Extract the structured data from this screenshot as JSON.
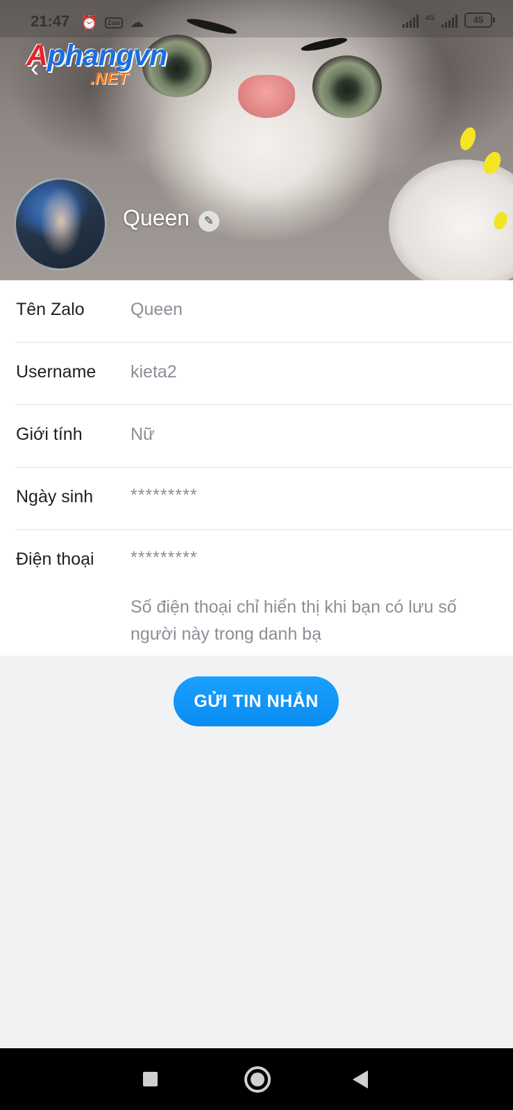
{
  "status_bar": {
    "time": "21:47",
    "network_label": "4G",
    "battery": "45"
  },
  "watermark": {
    "first_letter": "A",
    "rest": "phangvn",
    "suffix": ".NET"
  },
  "profile": {
    "name": "Queen"
  },
  "info": {
    "rows": [
      {
        "label": "Tên Zalo",
        "value": "Queen"
      },
      {
        "label": "Username",
        "value": "kieta2"
      },
      {
        "label": "Giới tính",
        "value": "Nữ"
      },
      {
        "label": "Ngày sinh",
        "value": "*********"
      },
      {
        "label": "Điện thoại",
        "value": "*********"
      }
    ],
    "phone_note": "Số điện thoại chỉ hiển thị khi bạn có lưu số người này trong danh bạ"
  },
  "actions": {
    "send_message": "GỬI TIN NHẮN"
  },
  "colors": {
    "accent": "#0a8cf0",
    "background": "#f1f2f4"
  },
  "icons": {
    "back": "arrow-left-icon",
    "edit": "pencil-icon",
    "alarm": "alarm-icon",
    "cloud": "cloud-icon"
  }
}
